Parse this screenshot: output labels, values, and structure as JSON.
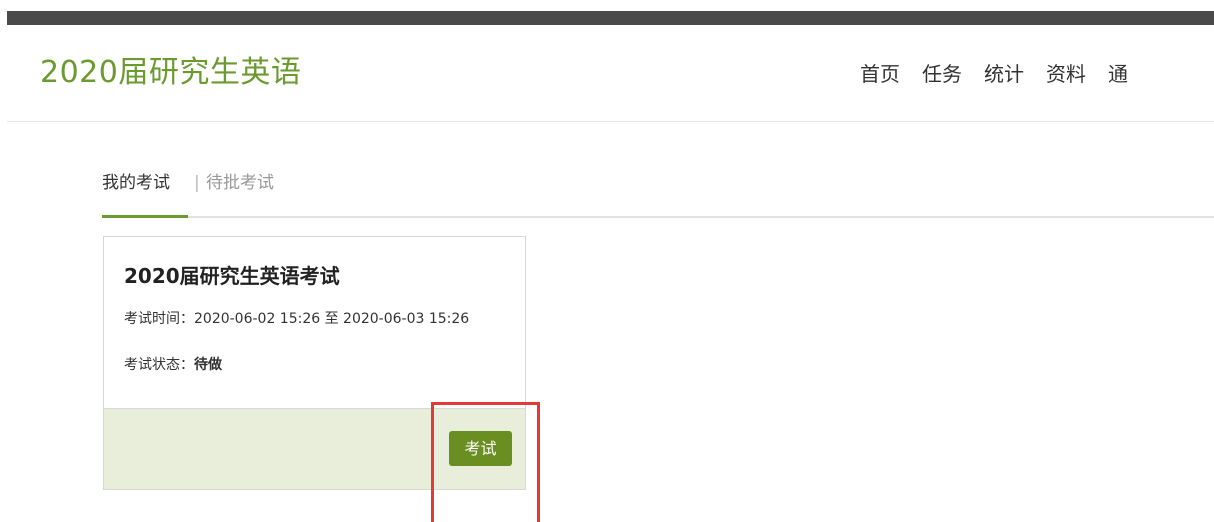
{
  "header": {
    "course_title": "2020届研究生英语",
    "nav": [
      "首页",
      "任务",
      "统计",
      "资料",
      "通"
    ]
  },
  "tabs": {
    "active": "我的考试",
    "separator": "|",
    "inactive": "待批考试"
  },
  "exam_card": {
    "title": "2020届研究生英语考试",
    "time_label": "考试时间：",
    "time_value": "2020-06-02 15:26 至 2020-06-03 15:26",
    "status_label": "考试状态：",
    "status_value": "待做",
    "button_label": "考试"
  },
  "colors": {
    "accent": "#6b9a2f",
    "button": "#6b8e23",
    "footer_bg": "#e8eed9",
    "highlight": "#e53935",
    "top_bar": "#4a4a4a"
  }
}
